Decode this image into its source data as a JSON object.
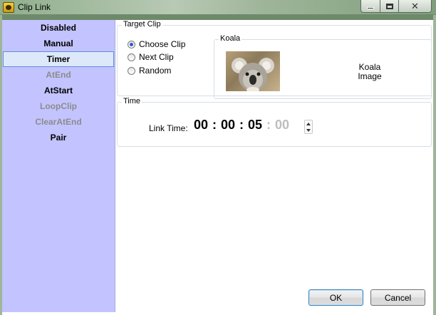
{
  "window": {
    "title": "Clip Link"
  },
  "sidebar": {
    "items": [
      {
        "label": "Disabled",
        "state": "normal"
      },
      {
        "label": "Manual",
        "state": "normal"
      },
      {
        "label": "Timer",
        "state": "selected"
      },
      {
        "label": "AtEnd",
        "state": "disabled"
      },
      {
        "label": "AtStart",
        "state": "normal"
      },
      {
        "label": "LoopClip",
        "state": "disabled"
      },
      {
        "label": "ClearAtEnd",
        "state": "disabled"
      },
      {
        "label": "Pair",
        "state": "normal"
      }
    ]
  },
  "target_clip": {
    "legend": "Target Clip",
    "options": [
      {
        "label": "Choose Clip",
        "checked": true
      },
      {
        "label": "Next Clip",
        "checked": false
      },
      {
        "label": "Random",
        "checked": false
      }
    ],
    "preview": {
      "legend": "Koala",
      "caption_line1": "Koala",
      "caption_line2": "Image"
    }
  },
  "time": {
    "legend": "Time",
    "link_label": "Link Time:",
    "hours": "00",
    "minutes": "00",
    "seconds": "05",
    "frames": "00",
    "separator": ":"
  },
  "buttons": {
    "ok": "OK",
    "cancel": "Cancel"
  },
  "colors": {
    "sidebar_bg": "#c3c3ff",
    "selection_border": "#5b8fd6",
    "disabled_text": "#8c8c8c"
  }
}
